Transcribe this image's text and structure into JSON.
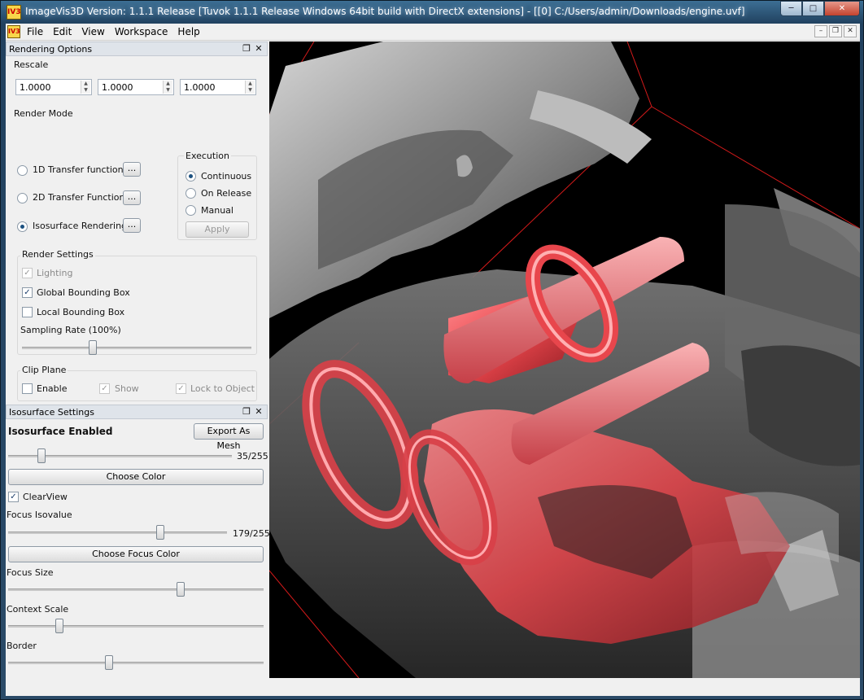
{
  "window": {
    "title": "ImageVis3D Version: 1.1.1 Release [Tuvok 1.1.1 Release Windows 64bit build with DirectX extensions] - [[0] C:/Users/admin/Downloads/engine.uvf]",
    "icon_label": "IV3"
  },
  "menu": {
    "items": [
      {
        "label": "File"
      },
      {
        "label": "Edit"
      },
      {
        "label": "View"
      },
      {
        "label": "Workspace"
      },
      {
        "label": "Help"
      }
    ]
  },
  "rendering_options": {
    "title": "Rendering Options",
    "rescale": {
      "label": "Rescale",
      "x": "1.0000",
      "y": "1.0000",
      "z": "1.0000"
    },
    "render_mode": {
      "label": "Render Mode",
      "options": [
        {
          "label": "1D Transfer function",
          "selected": false
        },
        {
          "label": "2D Transfer Function",
          "selected": false
        },
        {
          "label": "Isosurface Rendering",
          "selected": true
        }
      ],
      "more_label": "..."
    },
    "execution": {
      "label": "Execution",
      "options": [
        {
          "label": "Continuous",
          "selected": true
        },
        {
          "label": "On Release",
          "selected": false
        },
        {
          "label": "Manual",
          "selected": false
        }
      ],
      "apply_label": "Apply"
    },
    "render_settings": {
      "label": "Render Settings",
      "lighting": {
        "label": "Lighting",
        "checked": true,
        "enabled": false
      },
      "global_bbox": {
        "label": "Global Bounding Box",
        "checked": true
      },
      "local_bbox": {
        "label": "Local Bounding Box",
        "checked": false
      },
      "sampling_rate_label": "Sampling Rate (100%)",
      "sampling_rate": 0.3
    },
    "clip_plane": {
      "label": "Clip Plane",
      "enable": {
        "label": "Enable",
        "checked": false
      },
      "show": {
        "label": "Show",
        "checked": true,
        "enabled": false
      },
      "lock": {
        "label": "Lock to Object",
        "checked": true,
        "enabled": false
      }
    }
  },
  "isosurface_settings": {
    "title": "Isosurface Settings",
    "enabled_label": "Isosurface Enabled",
    "export_label": "Export As Mesh",
    "isovalue": {
      "text": "35/255",
      "fraction": 0.137
    },
    "choose_color_label": "Choose Color",
    "clearview": {
      "label": "ClearView",
      "checked": true
    },
    "focus_isovalue_label": "Focus Isovalue",
    "focus_isovalue": {
      "text": "179/255",
      "fraction": 0.702
    },
    "choose_focus_color_label": "Choose Focus Color",
    "focus_size_label": "Focus Size",
    "focus_size": 0.68,
    "context_scale_label": "Context Scale",
    "context_scale": 0.19,
    "border_label": "Border",
    "border": 0.39
  },
  "colors": {
    "focus_color": "#e8464c",
    "context_color": "#8a8a8a",
    "bbox_color": "#d41a1a"
  }
}
